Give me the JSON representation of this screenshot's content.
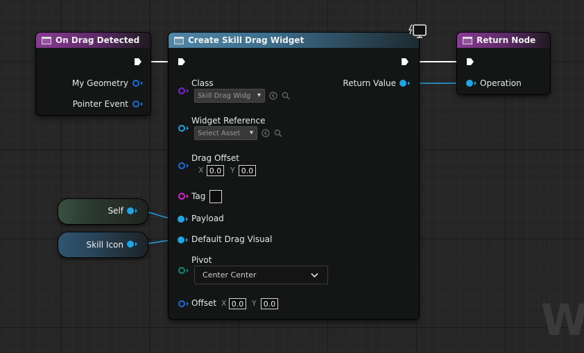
{
  "nodes": {
    "on_drag_detected": {
      "title": "On Drag Detected",
      "pins": {
        "geometry": "My Geometry",
        "pointer": "Pointer Event"
      }
    },
    "create_widget": {
      "title": "Create Skill Drag Widget",
      "return_value": "Return Value",
      "class_label": "Class",
      "class_value": "Skill Drag Widg",
      "widget_ref_label": "Widget Reference",
      "widget_ref_value": "Select Asset",
      "drag_offset_label": "Drag Offset",
      "drag_offset_x": "0.0",
      "drag_offset_y": "0.0",
      "tag_label": "Tag",
      "payload_label": "Payload",
      "default_visual_label": "Default Drag Visual",
      "pivot_label": "Pivot",
      "pivot_value": "Center Center",
      "offset_label": "Offset",
      "offset_x": "0.0",
      "offset_y": "0.0",
      "axis_x": "X",
      "axis_y": "Y"
    },
    "return_node": {
      "title": "Return Node",
      "operation": "Operation"
    },
    "self_var": {
      "label": "Self"
    },
    "skill_icon_var": {
      "label": "Skill Icon"
    }
  },
  "watermark": "W",
  "colors": {
    "header_purple": "#8a3a96",
    "header_blue": "#4f86a6",
    "object_pin": "#1ea5e8",
    "exec_wire": "#ffffff"
  }
}
